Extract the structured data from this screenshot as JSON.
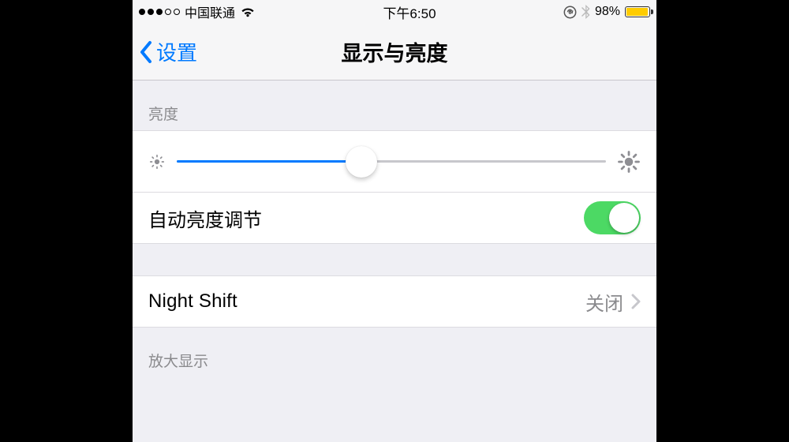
{
  "statusbar": {
    "signal_filled": 3,
    "signal_total": 5,
    "carrier": "中国联通",
    "time": "下午6:50",
    "battery_pct_label": "98%",
    "battery_pct_value": 98,
    "battery_color": "#ffcc00"
  },
  "navbar": {
    "back_label": "设置",
    "title": "显示与亮度"
  },
  "brightness_section": {
    "header": "亮度",
    "slider_value_pct": 43,
    "auto_label": "自动亮度调节",
    "auto_on": true
  },
  "night_shift": {
    "label": "Night Shift",
    "value": "关闭"
  },
  "zoom_section": {
    "header": "放大显示"
  }
}
